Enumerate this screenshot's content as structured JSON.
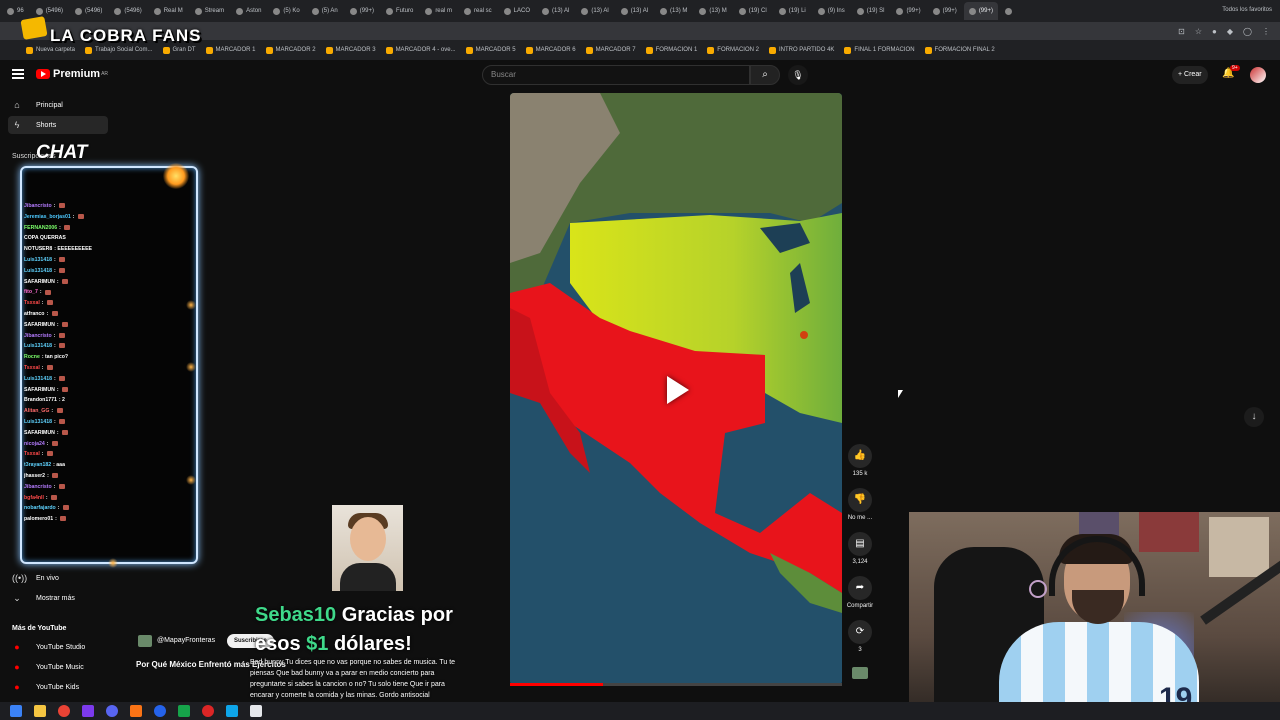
{
  "browser": {
    "tabs": [
      "96",
      "(5496)",
      "(5496)",
      "(5496)",
      "Real M",
      "Stream",
      "Aston",
      "(5) Ko",
      "(5) An",
      "(99+)",
      "Futuro",
      "real m",
      "real sc",
      "LACO",
      "(13) Al",
      "(13) Al",
      "(13) Al",
      "(13) M",
      "(13) M",
      "(19) Cl",
      "(19) Li",
      "(9) Ins",
      "(19) Sl",
      "(99+)",
      "(99+)",
      "(99+)",
      ""
    ],
    "bookmarks": [
      "Nueva carpeta",
      "Trabajo Social Com...",
      "Gran DT",
      "MARCADOR 1",
      "MARCADOR 2",
      "MARCADOR 3",
      "MARCADOR 4 - ove...",
      "MARCADOR 5",
      "MARCADOR 6",
      "MARCADOR 7",
      "FORMACION 1",
      "FORMACION 2",
      "INTRO PARTIDO 4K",
      "FINAL 1 FORMACION",
      "FORMACION FINAL 2"
    ],
    "all_bookmarks": "Todos los favoritos"
  },
  "overlay": {
    "stream_title": "LA COBRA FANS",
    "chat_label": "CHAT",
    "donation_name": "Sebas10",
    "donation_line1": " Gracias por",
    "donation_line2a": "esos ",
    "donation_amount": "$1",
    "donation_line2b": " dólares!",
    "donation_message": "Bad bunny Tu dices que no vas porque no sabes de musica. Tu te piensas Que bad bunny va a parar en medio concierto para preguntarte si sabes la cancion o no? Tu solo tiene Que ir para encarar y comerte la comida y las minas. Gordo antisocial",
    "donation_message_l1": "Bad bunny Tu dices que no vas porque no sabes de musica. Tu te",
    "donation_message_l2": "piensas Que bad bunny va a parar en medio concierto para",
    "donation_message_l3": "preguntarte si sabes la cancion o no? Tu solo tiene Que ir para",
    "donation_message_l4": "encarar y comerte la comida y las minas. Gordo antisocial"
  },
  "chat": [
    {
      "user": "Jibancristo",
      "msg": "",
      "color": "#b57cff"
    },
    {
      "user": "Jeremias_borjas01",
      "msg": "",
      "color": "#4dc9ff"
    },
    {
      "user": "FERNAN2006",
      "msg": "",
      "color": "#7cff6b"
    },
    {
      "user": "",
      "msg": "COPA QUERRAS",
      "color": "#ff5a5a"
    },
    {
      "user": "NOTUSER8",
      "msg": "EEEEEEEEEE",
      "color": "#ffffff"
    },
    {
      "user": "Luis131418",
      "msg": "",
      "color": "#5fd3ff"
    },
    {
      "user": "Luis131418",
      "msg": "",
      "color": "#5fd3ff"
    },
    {
      "user": "SAFARIMUN",
      "msg": "",
      "color": "#ffffff"
    },
    {
      "user": "fito_7",
      "msg": "",
      "color": "#ff6cd3"
    },
    {
      "user": "Tsxxal",
      "msg": "",
      "color": "#ff4a4a"
    },
    {
      "user": "atfranco",
      "msg": "",
      "color": "#ffffff"
    },
    {
      "user": "SAFARIMUN",
      "msg": "",
      "color": "#ffffff"
    },
    {
      "user": "Jibancristo",
      "msg": "",
      "color": "#b57cff"
    },
    {
      "user": "Luis131418",
      "msg": "",
      "color": "#5fd3ff"
    },
    {
      "user": "Rocne",
      "msg": "tan pico?",
      "color": "#7cff6b"
    },
    {
      "user": "Tsxxal",
      "msg": "",
      "color": "#ff4a4a"
    },
    {
      "user": "Luis131418",
      "msg": "",
      "color": "#5fd3ff"
    },
    {
      "user": "SAFARIMUN",
      "msg": "",
      "color": "#ffffff"
    },
    {
      "user": "Brandon1771",
      "msg": "2",
      "color": "#ffffff"
    },
    {
      "user": "Alitan_GG",
      "msg": "",
      "color": "#ff6c6c"
    },
    {
      "user": "Luis131418",
      "msg": "",
      "color": "#5fd3ff"
    },
    {
      "user": "SAFARIMUN",
      "msg": "",
      "color": "#ffffff"
    },
    {
      "user": "nicoja24",
      "msg": "",
      "color": "#b57cff"
    },
    {
      "user": "Tsxxal",
      "msg": "",
      "color": "#ff4a4a"
    },
    {
      "user": "t3rayan182",
      "msg": "aaa",
      "color": "#5fd3ff"
    },
    {
      "user": "jhasser2",
      "msg": "",
      "color": "#ffffff"
    },
    {
      "user": "Jibancristo",
      "msg": "",
      "color": "#b57cff"
    },
    {
      "user": "bgfa4nll",
      "msg": "",
      "color": "#ff4a4a"
    },
    {
      "user": "nobarfajardo",
      "msg": "",
      "color": "#5fd3ff"
    },
    {
      "user": "palomero01",
      "msg": "",
      "color": "#ffffff"
    }
  ],
  "youtube": {
    "logo": "Premium",
    "logo_region": "AR",
    "search_placeholder": "Buscar",
    "create_label": "Crear",
    "notif_count": "9+",
    "sidebar": {
      "home": "Principal",
      "shorts": "Shorts",
      "subscriptions": "Suscripciones",
      "live": "En vivo",
      "show_more": "Mostrar más",
      "more_from_youtube": "Más de YouTube",
      "studio": "YouTube Studio",
      "music": "YouTube Music",
      "kids": "YouTube Kids"
    }
  },
  "short": {
    "channel": "@MapayFronteras",
    "subscribe": "Suscribirse",
    "title": "Por Qué México Enfrentó más Ejércitos",
    "progress": 0.28,
    "actions": {
      "likes": "135 k",
      "dislike": "No me ...",
      "comments": "3,124",
      "share": "Compartir",
      "remix": "3"
    }
  },
  "streamer": {
    "jersey_number": "19"
  },
  "colors": {
    "accent_red": "#ff0000",
    "map_red": "#e8141b",
    "map_yellow": "#d9e419",
    "map_green": "#75b83d",
    "ocean": "#23506a",
    "donation_green": "#3fd98a"
  }
}
